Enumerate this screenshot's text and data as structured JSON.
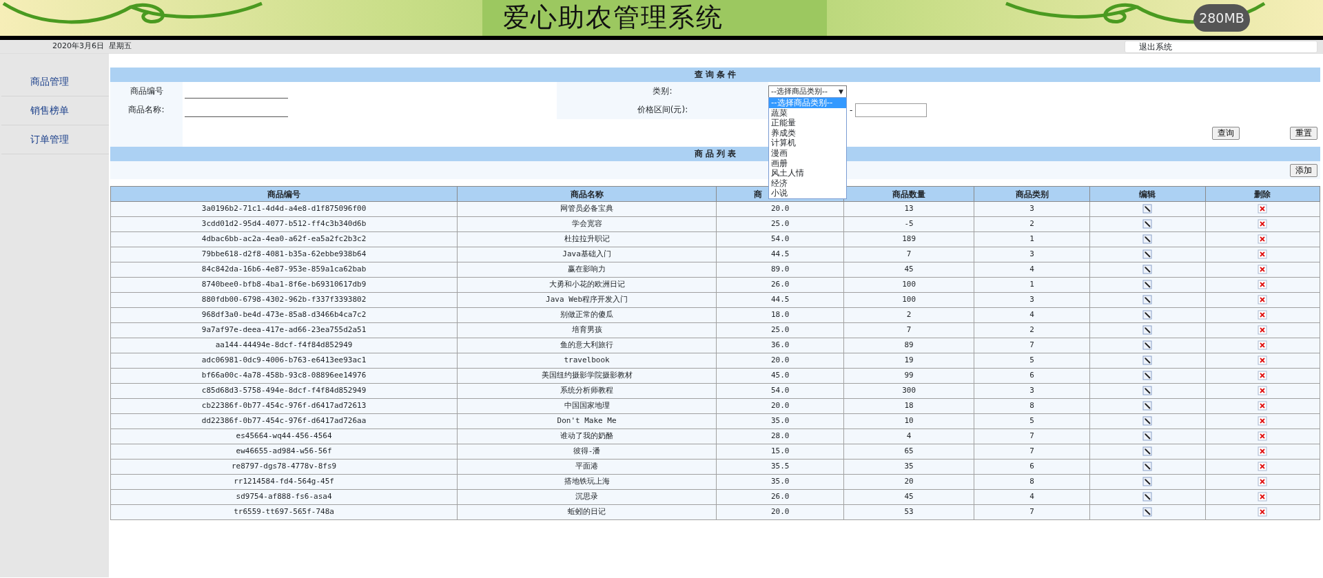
{
  "header": {
    "title": "爱心助农管理系统",
    "badge": "280MB"
  },
  "topbar": {
    "date": "2020年3月6日  星期五",
    "logout": "退出系统"
  },
  "sidebar": {
    "items": [
      {
        "label": "商品管理"
      },
      {
        "label": "销售榜单"
      },
      {
        "label": "订单管理"
      }
    ]
  },
  "query": {
    "title": "查 询 条 件",
    "fields": [
      {
        "label": "商品编号"
      },
      {
        "label": "商品名称:"
      }
    ],
    "category": {
      "label": "类别:",
      "value": "--选择商品类别--",
      "caret": "▼",
      "expanded": true,
      "options": [
        {
          "label": "--选择商品类别--",
          "selected": true
        },
        {
          "label": "蔬菜",
          "selected": false
        },
        {
          "label": "正能量",
          "selected": false
        },
        {
          "label": "养成类",
          "selected": false
        },
        {
          "label": "计算机",
          "selected": false
        },
        {
          "label": "漫画",
          "selected": false
        },
        {
          "label": "画册",
          "selected": false
        },
        {
          "label": "风土人情",
          "selected": false
        },
        {
          "label": "经济",
          "selected": false
        },
        {
          "label": "小说",
          "selected": false
        }
      ]
    },
    "price": {
      "label": "价格区间(元):",
      "separator": "-"
    },
    "buttons": [
      "查询",
      "重置"
    ]
  },
  "list": {
    "title": "商 品 列 表",
    "add_button": "添加",
    "columns": [
      "商品编号",
      "商品名称",
      "商",
      "商品数量",
      "商品类别",
      "编辑",
      "删除"
    ],
    "rows": [
      [
        "3a0196b2-71c1-4d4d-a4e8-d1f875096f00",
        "网管员必备宝典",
        "20.0",
        "13",
        "3"
      ],
      [
        "3cdd01d2-95d4-4077-b512-ff4c3b340d6b",
        "学会宽容",
        "25.0",
        "-5",
        "2"
      ],
      [
        "4dbac6bb-ac2a-4ea0-a62f-ea5a2fc2b3c2",
        "杜拉拉升职记",
        "54.0",
        "189",
        "1"
      ],
      [
        "79bbe618-d2f8-4081-b35a-62ebbe938b64",
        "Java基础入门",
        "44.5",
        "7",
        "3"
      ],
      [
        "84c842da-16b6-4e87-953e-859a1ca62bab",
        "赢在影响力",
        "89.0",
        "45",
        "4"
      ],
      [
        "8740bee0-bfb8-4ba1-8f6e-b69310617db9",
        "大勇和小花的欧洲日记",
        "26.0",
        "100",
        "1"
      ],
      [
        "880fdb00-6798-4302-962b-f337f3393802",
        "Java Web程序开发入门",
        "44.5",
        "100",
        "3"
      ],
      [
        "968df3a0-be4d-473e-85a8-d3466b4ca7c2",
        "别做正常的傻瓜",
        "18.0",
        "2",
        "4"
      ],
      [
        "9a7af97e-deea-417e-ad66-23ea755d2a51",
        "培育男孩",
        "25.0",
        "7",
        "2"
      ],
      [
        "aa144-44494e-8dcf-f4f84d852949",
        "鱼的意大利旅行",
        "36.0",
        "89",
        "7"
      ],
      [
        "adc06981-0dc9-4006-b763-e6413ee93ac1",
        "travelbook",
        "20.0",
        "19",
        "5"
      ],
      [
        "bf66a00c-4a78-458b-93c8-08896ee14976",
        "美国纽约摄影学院摄影教材",
        "45.0",
        "99",
        "6"
      ],
      [
        "c85d68d3-5758-494e-8dcf-f4f84d852949",
        "系统分析师教程",
        "54.0",
        "300",
        "3"
      ],
      [
        "cb22386f-0b77-454c-976f-d6417ad72613",
        "中国国家地理",
        "20.0",
        "18",
        "8"
      ],
      [
        "dd22386f-0b77-454c-976f-d6417ad726aa",
        "Don't Make Me",
        "35.0",
        "10",
        "5"
      ],
      [
        "es45664-wq44-456-4564",
        "谁动了我的奶酪",
        "28.0",
        "4",
        "7"
      ],
      [
        "ew46655-ad984-w56-56f",
        "彼得-潘",
        "15.0",
        "65",
        "7"
      ],
      [
        "re8797-dgs78-4778v-8fs9",
        "平面港",
        "35.5",
        "35",
        "6"
      ],
      [
        "rr1214584-fd4-564g-45f",
        "搭地铁玩上海",
        "35.0",
        "20",
        "8"
      ],
      [
        "sd9754-af888-fs6-asa4",
        "沉思录",
        "26.0",
        "45",
        "4"
      ],
      [
        "tr6559-tt697-565f-748a",
        "蚯蚓的日记",
        "20.0",
        "53",
        "7"
      ]
    ]
  }
}
